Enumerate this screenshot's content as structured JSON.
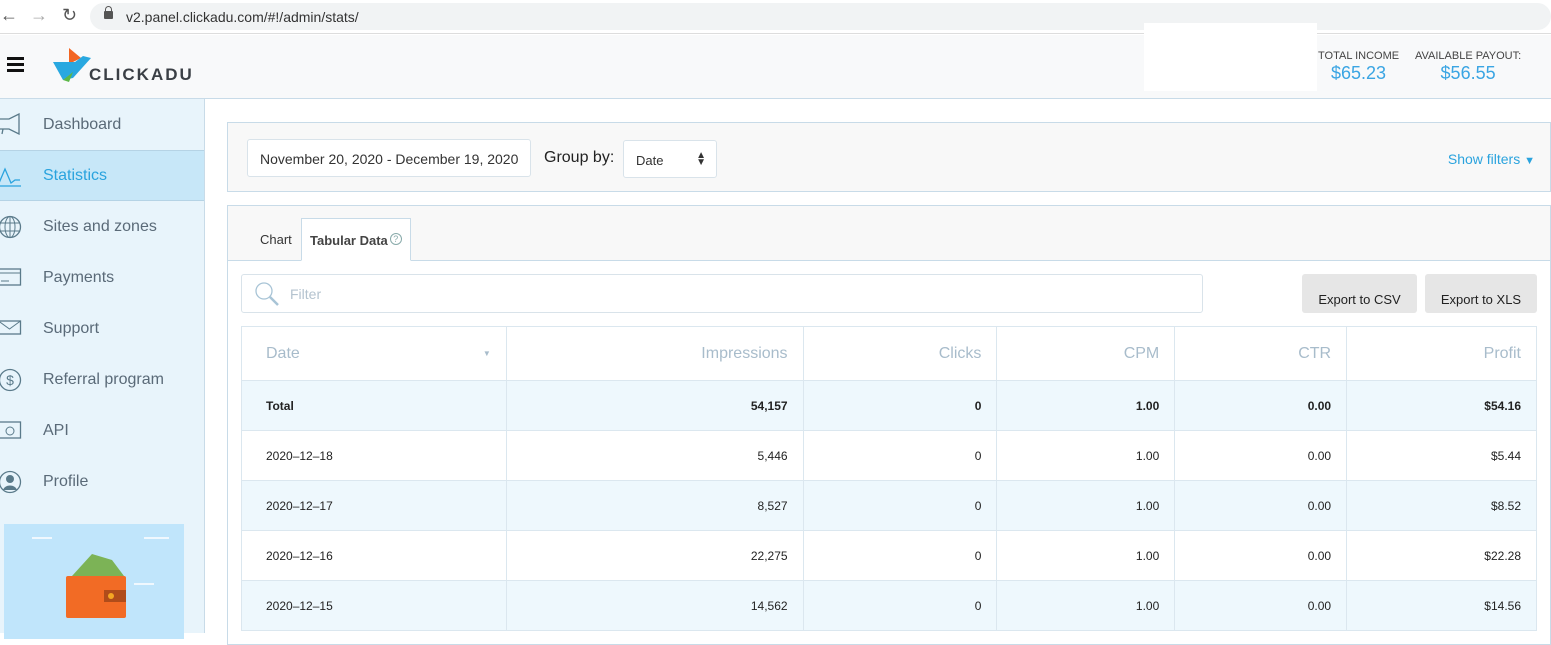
{
  "browser": {
    "url": "v2.panel.clickadu.com/#!/admin/stats/"
  },
  "header": {
    "logo": "CLICKADU",
    "total_income_label": "TOTAL INCOME",
    "total_income": "$65.23",
    "payout_label": "AVAILABLE PAYOUT:",
    "payout": "$56.55"
  },
  "sidebar": {
    "items": [
      {
        "label": "Dashboard",
        "icon": "megaphone-icon"
      },
      {
        "label": "Statistics",
        "icon": "chart-line-icon",
        "active": true
      },
      {
        "label": "Sites and zones",
        "icon": "globe-icon"
      },
      {
        "label": "Payments",
        "icon": "card-icon"
      },
      {
        "label": "Support",
        "icon": "envelope-icon"
      },
      {
        "label": "Referral program",
        "icon": "dollar-icon"
      },
      {
        "label": "API",
        "icon": "api-icon"
      },
      {
        "label": "Profile",
        "icon": "user-icon"
      }
    ]
  },
  "filters": {
    "date_range": "November 20, 2020 - December 19, 2020",
    "group_by_label": "Group by:",
    "group_by_value": "Date",
    "show_filters": "Show filters"
  },
  "tabs": [
    {
      "label": "Chart"
    },
    {
      "label": "Tabular Data",
      "active": true
    }
  ],
  "table": {
    "filter_placeholder": "Filter",
    "export_csv": "Export to CSV",
    "export_xls": "Export to XLS",
    "columns": [
      "Date",
      "Impressions",
      "Clicks",
      "CPM",
      "CTR",
      "Profit"
    ],
    "rows": [
      [
        "Total",
        "54,157",
        "0",
        "1.00",
        "0.00",
        "$54.16"
      ],
      [
        "2020–12–18",
        "5,446",
        "0",
        "1.00",
        "0.00",
        "$5.44"
      ],
      [
        "2020–12–17",
        "8,527",
        "0",
        "1.00",
        "0.00",
        "$8.52"
      ],
      [
        "2020–12–16",
        "22,275",
        "0",
        "1.00",
        "0.00",
        "$22.28"
      ],
      [
        "2020–12–15",
        "14,562",
        "0",
        "1.00",
        "0.00",
        "$14.56"
      ]
    ]
  }
}
